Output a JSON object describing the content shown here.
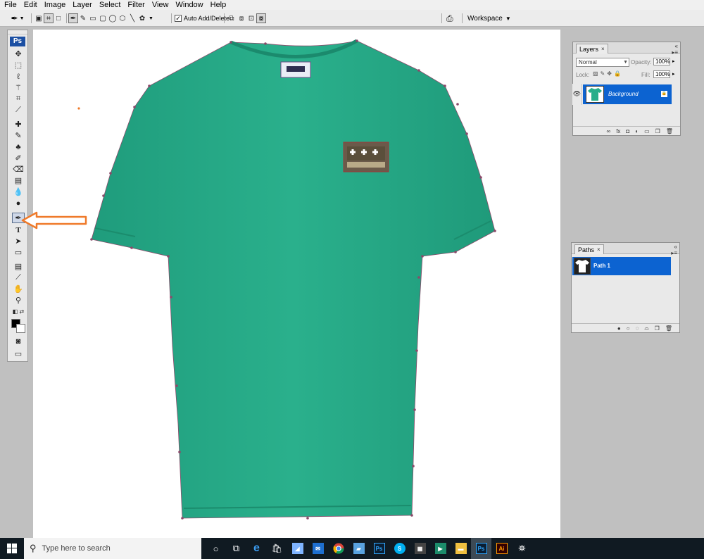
{
  "menu": [
    "File",
    "Edit",
    "Image",
    "Layer",
    "Select",
    "Filter",
    "View",
    "Window",
    "Help"
  ],
  "options_bar": {
    "auto_add_delete_label": "Auto Add/Delete",
    "auto_add_delete_checked": true,
    "workspace_label": "Workspace"
  },
  "toolbox": {
    "logo": "Ps",
    "active_tool": "pen-tool",
    "foreground_color": "#000000",
    "background_color": "#ffffff"
  },
  "layers_panel": {
    "tab": "Layers",
    "blend_mode": "Normal",
    "opacity_label": "Opacity:",
    "opacity_value": "100%",
    "lock_label": "Lock:",
    "fill_label": "Fill:",
    "fill_value": "100%",
    "layers": [
      {
        "name": "Background",
        "selected": true,
        "visible": true,
        "locked": true
      }
    ]
  },
  "paths_panel": {
    "tab": "Paths",
    "paths": [
      {
        "name": "Path 1",
        "selected": true
      }
    ]
  },
  "taskbar": {
    "search_placeholder": "Type here to search",
    "apps": [
      "cortana",
      "task-view",
      "edge",
      "store",
      "app",
      "mail",
      "chrome",
      "app",
      "photoshop",
      "skype",
      "calculator",
      "app",
      "file-explorer",
      "photoshop",
      "illustrator",
      "network"
    ]
  },
  "colors": {
    "shirt": "#27ae8a",
    "path_point": "#8a4a6a",
    "annotation_arrow": "#ef7a2a",
    "selection_blue": "#0c63d1"
  }
}
